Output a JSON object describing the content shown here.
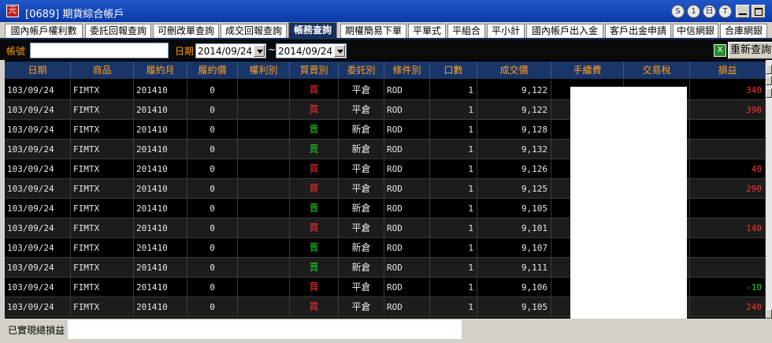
{
  "window": {
    "title": "[0689] 期貨綜合帳戶",
    "app_icon": "元",
    "title_buttons": [
      "S",
      "1",
      "日",
      "T"
    ]
  },
  "tabs": [
    {
      "label": "國內帳戶權利數",
      "active": false
    },
    {
      "label": "委託回報查詢",
      "active": false
    },
    {
      "label": "可刪改單查詢",
      "active": false
    },
    {
      "label": "成交回報查詢",
      "active": false
    },
    {
      "label": "帳務查詢",
      "active": true
    },
    {
      "label": "期權簡易下單",
      "active": false
    },
    {
      "label": "平單式",
      "active": false
    },
    {
      "label": "平組合",
      "active": false
    },
    {
      "label": "平小計",
      "active": false
    },
    {
      "label": "國內帳戶出入金",
      "active": false
    },
    {
      "label": "客戶出金申請",
      "active": false
    },
    {
      "label": "中信網銀",
      "active": false
    },
    {
      "label": "合庫網銀",
      "active": false
    }
  ],
  "filter": {
    "account_label": "帳號",
    "date_label": "日期",
    "start_date": "2014/09/24",
    "tilde": "~",
    "end_date": "2014/09/24",
    "requery_label": "重新查詢",
    "excel_icon": "X"
  },
  "table": {
    "columns": [
      "日期",
      "商品",
      "履約月",
      "履約價",
      "權利別",
      "買賣別",
      "委託別",
      "條件別",
      "口數",
      "成交價",
      "手續費",
      "交易稅",
      "損益"
    ],
    "rows": [
      {
        "date": "103/09/24",
        "product": "FIMTX",
        "month": "201410",
        "strike": "0",
        "right": "",
        "side": "買",
        "order": "平倉",
        "cond": "ROD",
        "qty": "1",
        "price": "9,122",
        "fee": "",
        "tax": "",
        "pnl": "340"
      },
      {
        "date": "103/09/24",
        "product": "FIMTX",
        "month": "201410",
        "strike": "0",
        "right": "",
        "side": "買",
        "order": "平倉",
        "cond": "ROD",
        "qty": "1",
        "price": "9,122",
        "fee": "",
        "tax": "",
        "pnl": "390"
      },
      {
        "date": "103/09/24",
        "product": "FIMTX",
        "month": "201410",
        "strike": "0",
        "right": "",
        "side": "賣",
        "order": "新倉",
        "cond": "ROD",
        "qty": "1",
        "price": "9,128",
        "fee": "",
        "tax": "",
        "pnl": ""
      },
      {
        "date": "103/09/24",
        "product": "FIMTX",
        "month": "201410",
        "strike": "0",
        "right": "",
        "side": "賣",
        "order": "新倉",
        "cond": "ROD",
        "qty": "1",
        "price": "9,132",
        "fee": "",
        "tax": "",
        "pnl": ""
      },
      {
        "date": "103/09/24",
        "product": "FIMTX",
        "month": "201410",
        "strike": "0",
        "right": "",
        "side": "買",
        "order": "平倉",
        "cond": "ROD",
        "qty": "1",
        "price": "9,126",
        "fee": "",
        "tax": "",
        "pnl": "40"
      },
      {
        "date": "103/09/24",
        "product": "FIMTX",
        "month": "201410",
        "strike": "0",
        "right": "",
        "side": "買",
        "order": "平倉",
        "cond": "ROD",
        "qty": "1",
        "price": "9,125",
        "fee": "",
        "tax": "",
        "pnl": "290"
      },
      {
        "date": "103/09/24",
        "product": "FIMTX",
        "month": "201410",
        "strike": "0",
        "right": "",
        "side": "賣",
        "order": "新倉",
        "cond": "ROD",
        "qty": "1",
        "price": "9,105",
        "fee": "",
        "tax": "",
        "pnl": ""
      },
      {
        "date": "103/09/24",
        "product": "FIMTX",
        "month": "201410",
        "strike": "0",
        "right": "",
        "side": "買",
        "order": "平倉",
        "cond": "ROD",
        "qty": "1",
        "price": "9,101",
        "fee": "",
        "tax": "",
        "pnl": "140"
      },
      {
        "date": "103/09/24",
        "product": "FIMTX",
        "month": "201410",
        "strike": "0",
        "right": "",
        "side": "賣",
        "order": "新倉",
        "cond": "ROD",
        "qty": "1",
        "price": "9,107",
        "fee": "",
        "tax": "",
        "pnl": ""
      },
      {
        "date": "103/09/24",
        "product": "FIMTX",
        "month": "201410",
        "strike": "0",
        "right": "",
        "side": "賣",
        "order": "新倉",
        "cond": "ROD",
        "qty": "1",
        "price": "9,111",
        "fee": "",
        "tax": "",
        "pnl": ""
      },
      {
        "date": "103/09/24",
        "product": "FIMTX",
        "month": "201410",
        "strike": "0",
        "right": "",
        "side": "買",
        "order": "平倉",
        "cond": "ROD",
        "qty": "1",
        "price": "9,106",
        "fee": "",
        "tax": "",
        "pnl": "-10"
      },
      {
        "date": "103/09/24",
        "product": "FIMTX",
        "month": "201410",
        "strike": "0",
        "right": "",
        "side": "買",
        "order": "平倉",
        "cond": "ROD",
        "qty": "1",
        "price": "9,105",
        "fee": "",
        "tax": "",
        "pnl": "240"
      }
    ]
  },
  "footer": {
    "total_label": "已實現總損益"
  },
  "colors": {
    "buy": "#ff3030",
    "sell": "#22d022",
    "profit": "#ff3030",
    "loss": "#22d022",
    "header_text": "#ffa020"
  }
}
